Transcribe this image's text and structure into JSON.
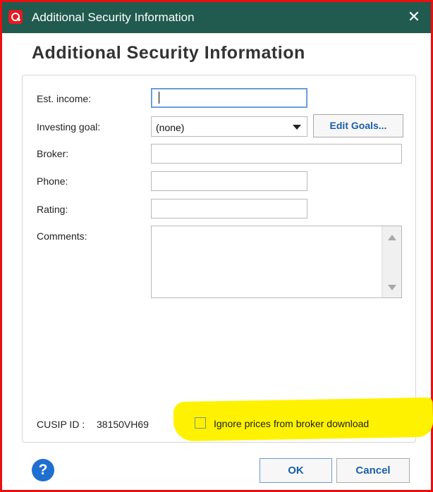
{
  "window": {
    "title": "Additional Security Information",
    "close_glyph": "✕"
  },
  "heading": "Additional Security Information",
  "form": {
    "est_income_label": "Est. income:",
    "est_income_value": "",
    "investing_goal_label": "Investing goal:",
    "investing_goal_value": "(none)",
    "edit_goals_label": "Edit Goals...",
    "broker_label": "Broker:",
    "broker_value": "",
    "phone_label": "Phone:",
    "phone_value": "",
    "rating_label": "Rating:",
    "rating_value": "",
    "comments_label": "Comments:",
    "comments_value": ""
  },
  "footer": {
    "cusip_label": "CUSIP ID :",
    "cusip_value": "38150VH69",
    "ignore_prices_label": "Ignore prices from broker download",
    "ignore_prices_checked": false
  },
  "buttons": {
    "ok_label": "OK",
    "cancel_label": "Cancel",
    "help_glyph": "?"
  },
  "colors": {
    "titlebar": "#215a4e",
    "window_border": "#e81010",
    "highlight": "#fff200",
    "button_text": "#1a5fa8",
    "help_icon": "#1f6fd0"
  },
  "icons": [
    "app-logo-icon",
    "close-icon",
    "dropdown-arrow-icon",
    "scroll-up-icon",
    "scroll-down-icon",
    "help-icon"
  ]
}
